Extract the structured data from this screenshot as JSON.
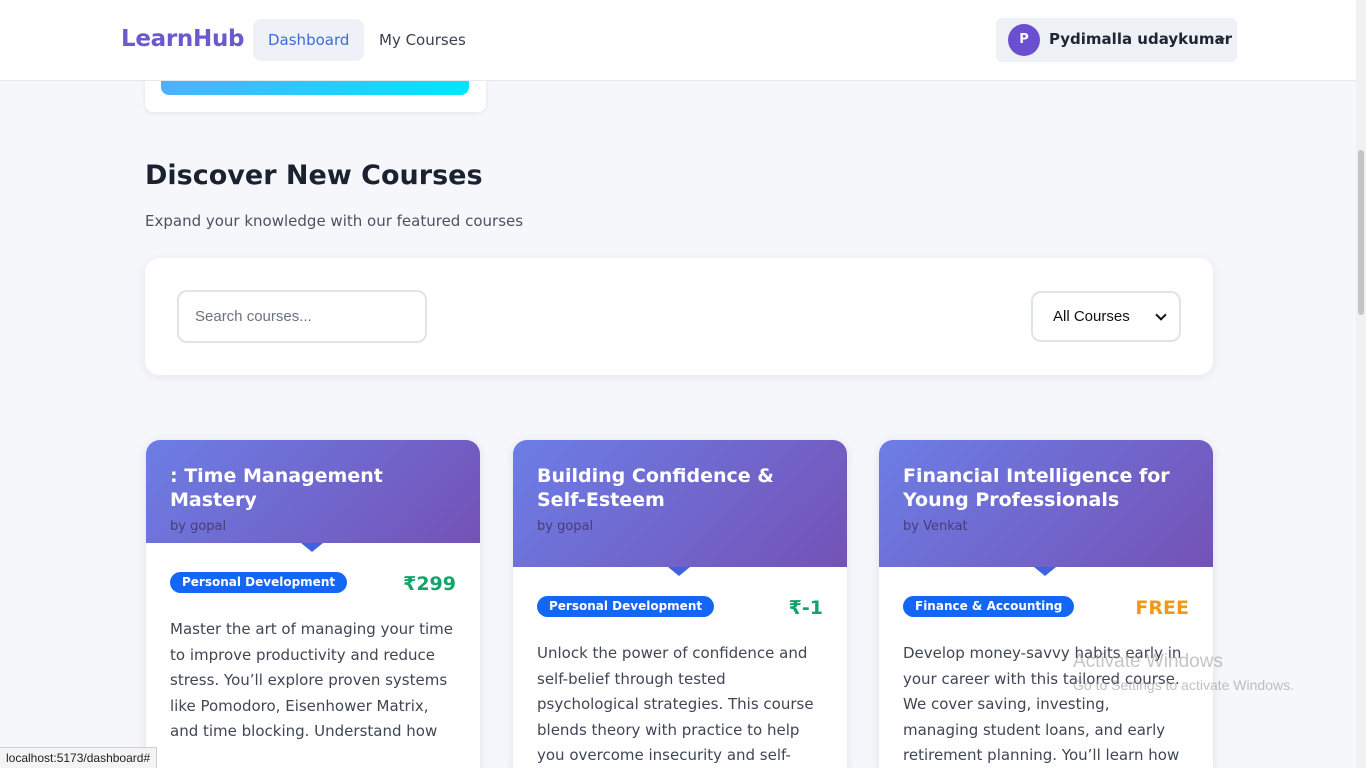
{
  "navbar": {
    "logo": "LearnHub",
    "links": [
      {
        "label": "Dashboard",
        "active": true
      },
      {
        "label": "My Courses",
        "active": false
      }
    ],
    "user": {
      "initial": "P",
      "name": "Pydimalla udaykumar"
    }
  },
  "section": {
    "title": "Discover New Courses",
    "subtitle": "Expand your knowledge with our featured courses"
  },
  "filters": {
    "search_placeholder": "Search courses...",
    "category_selected": "All Courses"
  },
  "courses": [
    {
      "title": ": Time Management Mastery",
      "author": "by gopal",
      "category": "Personal Development",
      "price": "₹299",
      "description": "Master the art of managing your time to improve productivity and reduce stress. You’ll explore proven systems like Pomodoro, Eisenhower Matrix, and time blocking. Understand how"
    },
    {
      "title": "Building Confidence & Self-Esteem",
      "author": "by gopal",
      "category": "Personal Development",
      "price": "₹-1",
      "description": "Unlock the power of confidence and self-belief through tested psychological strategies. This course blends theory with practice to help you overcome insecurity and self-doubt."
    },
    {
      "title": "Financial Intelligence for Young Professionals",
      "author": "by Venkat",
      "category": "Finance & Accounting",
      "price": "FREE",
      "description": "Develop money-savvy habits early in your career with this tailored course. We cover saving, investing, managing student loans, and early retirement planning. You’ll learn how to align"
    }
  ],
  "watermark": {
    "title": "Activate Windows",
    "subtitle": "Go to Settings to activate Windows."
  },
  "status_bar": {
    "url": "localhost:5173/dashboard#"
  },
  "colors": {
    "brand": "#6a5acd",
    "active_link": "#3f6ad8",
    "badge": "#1466f5",
    "price_paid": "#14a36a",
    "price_free": "#ee9a16",
    "card_header_start": "#6c7ee6",
    "card_header_end": "#7452b6"
  }
}
